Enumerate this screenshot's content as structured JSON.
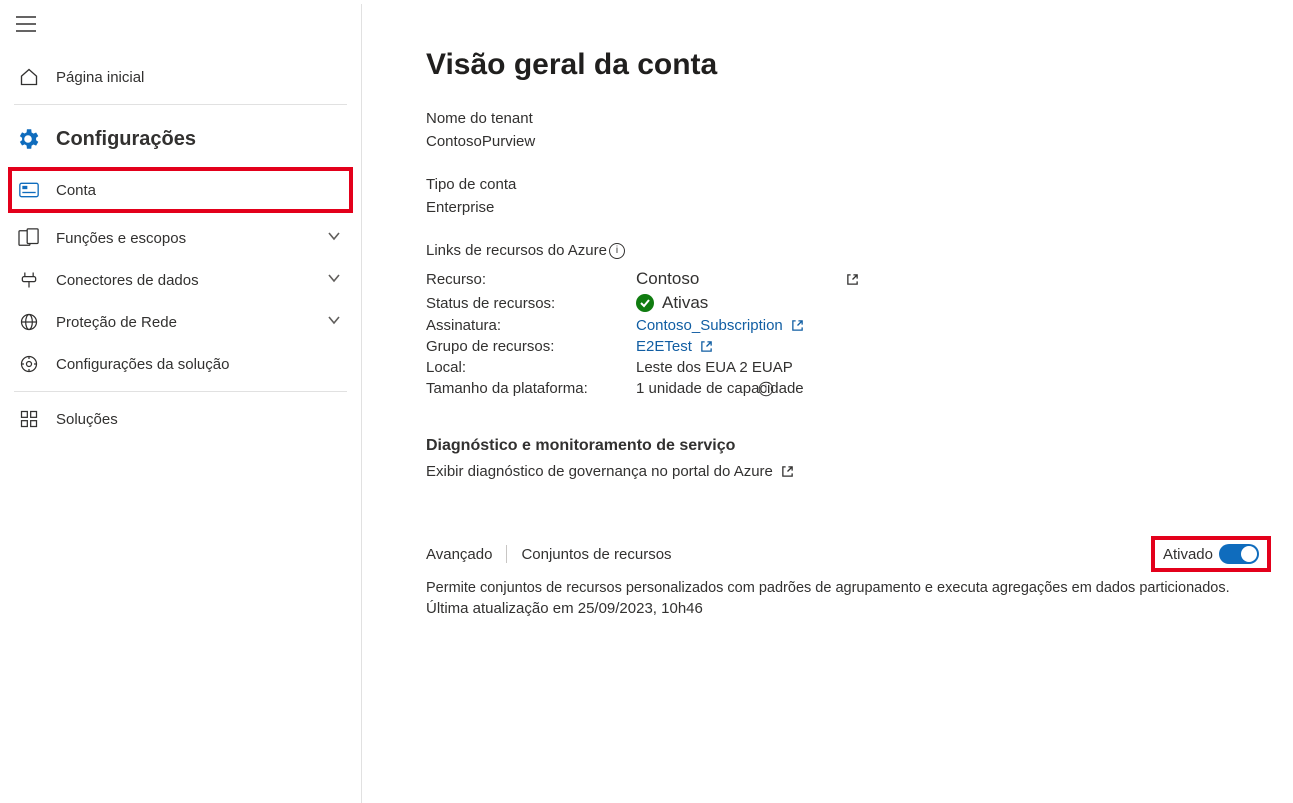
{
  "sidebar": {
    "home_label": "Página inicial",
    "settings_header": "Configurações",
    "items": {
      "account": "Conta",
      "roles": "Funções e escopos",
      "connectors": "Conectores de dados",
      "network": "Proteção de Rede",
      "solution_settings": "Configurações da solução",
      "solutions": "Soluções"
    }
  },
  "main": {
    "title": "Visão geral da conta",
    "tenant_label": "Nome do tenant",
    "tenant_value": "ContosoPurview",
    "account_type_label": "Tipo de conta",
    "account_type_value": "Enterprise",
    "azure_links_heading": "Links de recursos do Azure",
    "rows": {
      "resource_label": "Recurso:",
      "resource_value": "Contoso",
      "status_label": "Status de recursos:",
      "status_value": "Ativas",
      "subscription_label": "Assinatura:",
      "subscription_value": "Contoso_Subscription",
      "rg_label": "Grupo de recursos:",
      "rg_value": "E2ETest",
      "location_label": "Local:",
      "location_value": "Leste dos EUA 2 EUAP",
      "platform_size_label": "Tamanho da plataforma:",
      "platform_size_value": "1 unidade de capacidade"
    },
    "diag_heading": "Diagnóstico e monitoramento de serviço",
    "diag_link": "Exibir diagnóstico de governança no portal do Azure",
    "advanced": {
      "label": "Avançado",
      "resource_sets": "Conjuntos de recursos",
      "toggle_label": "Ativado",
      "description": "Permite conjuntos de recursos personalizados com padrões de agrupamento e executa agregações em dados particionados.",
      "last_updated": "Última atualização em 25/09/2023, 10h46"
    }
  }
}
